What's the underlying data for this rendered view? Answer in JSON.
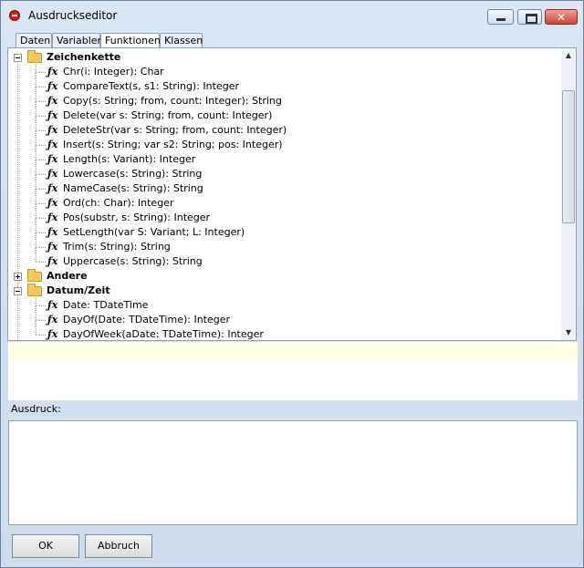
{
  "window": {
    "title": "Ausdruckseditor"
  },
  "tabs": [
    "Daten",
    "Variablen",
    "Funktionen",
    "Klassen"
  ],
  "tree": {
    "categories": [
      {
        "name": "Zeichenkette",
        "expanded": true,
        "functions": [
          "Chr(i: Integer): Char",
          "CompareText(s, s1: String): Integer",
          "Copy(s: String; from, count: Integer): String",
          "Delete(var s: String; from, count: Integer)",
          "DeleteStr(var s: String; from, count: Integer)",
          "Insert(s: String; var s2: String; pos: Integer)",
          "Length(s: Variant): Integer",
          "Lowercase(s: String): String",
          "NameCase(s: String): String",
          "Ord(ch: Char): Integer",
          "Pos(substr, s: String): Integer",
          "SetLength(var S: Variant; L: Integer)",
          "Trim(s: String): String",
          "Uppercase(s: String): String"
        ]
      },
      {
        "name": "Andere",
        "expanded": false,
        "functions": []
      },
      {
        "name": "Datum/Zeit",
        "expanded": true,
        "functions": [
          "Date: TDateTime",
          "DayOf(Date: TDateTime): Integer",
          "DayOfWeek(aDate: TDateTime): Integer"
        ]
      }
    ],
    "fx_icon": "fx"
  },
  "expression": {
    "label": "Ausdruck:",
    "value": ""
  },
  "buttons": {
    "ok": "OK",
    "cancel": "Abbruch"
  },
  "icons": {
    "app": "stop-sign-icon",
    "minimize": "minimize-icon",
    "maximize": "maximize-icon",
    "close": "close-icon",
    "folder": "folder-icon",
    "function": "function-icon"
  },
  "colors": {
    "hint_background": "#ffffe4",
    "close_button": "#c9473a",
    "folder": "#f0c860"
  }
}
